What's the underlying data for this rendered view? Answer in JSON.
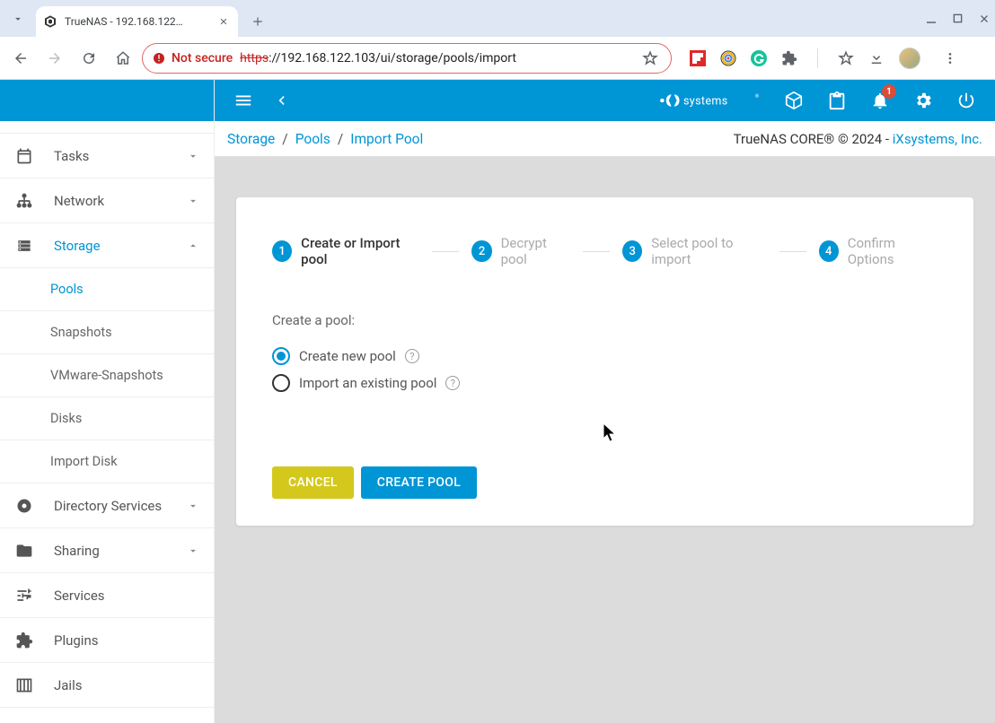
{
  "browser": {
    "tab_title": "TrueNAS - 192.168.122…",
    "url_scheme": "https",
    "url_rest": "://192.168.122.103/ui/storage/pools/import",
    "not_secure": "Not secure"
  },
  "topbar": {
    "brand": "iXsystems",
    "notifications": "1"
  },
  "breadcrumb": {
    "a": "Storage",
    "b": "Pools",
    "c": "Import Pool",
    "footer_left": "TrueNAS CORE® © 2024 - ",
    "footer_link": "iXsystems, Inc."
  },
  "sidebar": {
    "items": [
      {
        "label": "Tasks",
        "icon": "calendar",
        "expandable": true
      },
      {
        "label": "Network",
        "icon": "network",
        "expandable": true
      },
      {
        "label": "Storage",
        "icon": "storage",
        "expandable": true,
        "expanded": true,
        "active": true
      },
      {
        "label": "Directory Services",
        "icon": "dirsvc",
        "expandable": true
      },
      {
        "label": "Sharing",
        "icon": "folder",
        "expandable": true
      },
      {
        "label": "Services",
        "icon": "tune"
      },
      {
        "label": "Plugins",
        "icon": "puzzle"
      },
      {
        "label": "Jails",
        "icon": "jail"
      }
    ],
    "storage_children": [
      {
        "label": "Pools",
        "active": true
      },
      {
        "label": "Snapshots"
      },
      {
        "label": "VMware-Snapshots"
      },
      {
        "label": "Disks"
      },
      {
        "label": "Import Disk"
      }
    ]
  },
  "wizard": {
    "steps": [
      {
        "num": "1",
        "label": "Create or Import pool",
        "active": true
      },
      {
        "num": "2",
        "label": "Decrypt pool"
      },
      {
        "num": "3",
        "label": "Select pool to import"
      },
      {
        "num": "4",
        "label": "Confirm Options"
      }
    ],
    "section_title": "Create a pool:",
    "radio1": "Create new pool",
    "radio2": "Import an existing pool",
    "cancel": "CANCEL",
    "create": "CREATE POOL"
  }
}
